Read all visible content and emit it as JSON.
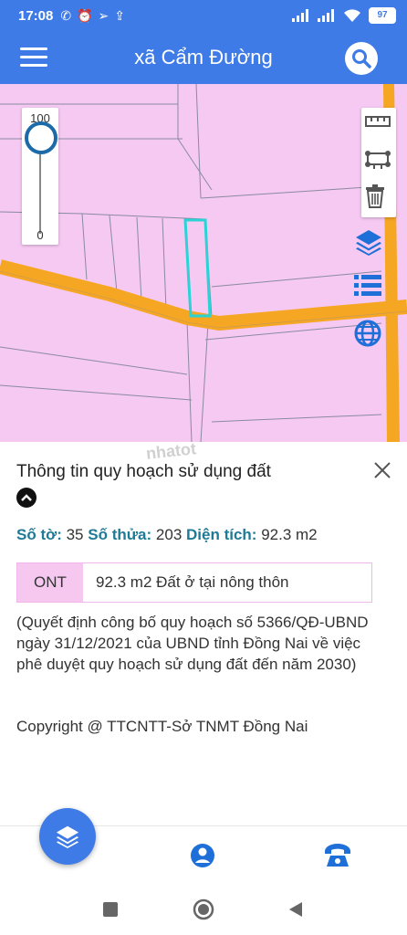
{
  "status_bar": {
    "time": "17:08",
    "battery": "97",
    "icons": [
      "missed-call-icon",
      "alarm-icon",
      "send-icon",
      "upload-icon",
      "signal-icon",
      "signal-icon",
      "wifi-icon",
      "battery-icon"
    ]
  },
  "app_bar": {
    "title": "xã Cẩm Đường",
    "menu_icon": "hamburger-menu-icon",
    "search_icon": "search-icon"
  },
  "map": {
    "zoom_max_label": "100",
    "zoom_min_label": "0",
    "zoom_level_percent": 100,
    "tools": [
      "ruler-measure-icon",
      "area-measure-icon",
      "trash-icon"
    ],
    "side_buttons": [
      "layers-icon",
      "list-icon",
      "globe-icon"
    ],
    "colors": {
      "land": "#f5c9f2",
      "road": "#f5a623",
      "selected_parcel": "#29d3d6",
      "parcel_line": "#8a8aa0"
    }
  },
  "panel": {
    "title": "Thông tin quy hoạch sử dụng đất",
    "watermark": "nhatot",
    "parcel": {
      "sheet_label": "Số tờ:",
      "sheet_value": "35",
      "plot_label": "Số thửa:",
      "plot_value": "203",
      "area_label": "Diện tích:",
      "area_value": "92.3 m2"
    },
    "land_use": {
      "code": "ONT",
      "description": "92.3 m2 Đất ở tại nông thôn"
    },
    "decision_text": "(Quyết định công bố quy hoạch số 5366/QĐ-UBND ngày 31/12/2021 của UBND tỉnh Đồng Nai về việc phê duyệt quy hoạch sử dụng đất đến năm 2030)",
    "copyright": "Copyright @ TTCNTT-Sở TNMT Đồng Nai"
  },
  "bottom_nav": {
    "fab_icon": "layers-icon",
    "items": [
      "account-icon",
      "phone-icon"
    ]
  },
  "system_nav": [
    "recent-apps-icon",
    "home-icon",
    "back-icon"
  ],
  "accent_color": "#3f7be6"
}
